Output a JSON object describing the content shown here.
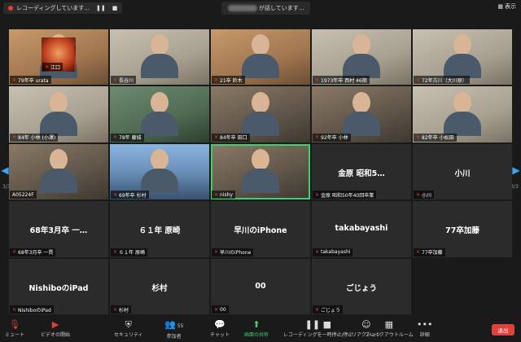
{
  "topbar": {
    "recording_text": "レコーディングしています...",
    "speaking_text": "が話しています...",
    "view_label": "表示"
  },
  "pager": {
    "left_page": "3/3",
    "right_page": "3/3"
  },
  "tiles": [
    {
      "name": "79年卒 urata",
      "center": "",
      "style": "video warm",
      "mic_off": true
    },
    {
      "name": "長谷川",
      "center": "",
      "style": "video light",
      "mic_off": true
    },
    {
      "name": "21卒 鈴木",
      "center": "",
      "style": "video warm",
      "mic_off": true
    },
    {
      "name": "1973年卒 西村 46期",
      "center": "",
      "style": "video light",
      "mic_off": true
    },
    {
      "name": "72年古川（大川原）",
      "center": "",
      "style": "video light",
      "mic_off": true
    },
    {
      "name": "84年 小林 (小澤)",
      "center": "",
      "style": "video light",
      "mic_off": true
    },
    {
      "name": "78年 藤城",
      "center": "",
      "style": "video green",
      "mic_off": true
    },
    {
      "name": "84年卒 田口",
      "center": "",
      "style": "video",
      "mic_off": true
    },
    {
      "name": "92年卒 小林",
      "center": "",
      "style": "video",
      "mic_off": true
    },
    {
      "name": "82年卒 小松田",
      "center": "",
      "style": "video light",
      "mic_off": true
    },
    {
      "name": "A05224F",
      "center": "",
      "style": "video",
      "mic_off": false
    },
    {
      "name": "69年卒 杉村",
      "center": "",
      "style": "video blue",
      "mic_off": true
    },
    {
      "name": "nishy",
      "center": "",
      "style": "video active",
      "mic_off": true
    },
    {
      "name": "金原 昭和50年40回卒業",
      "center": "金原 昭和5…",
      "style": "",
      "mic_off": true
    },
    {
      "name": "小川",
      "center": "小川",
      "style": "",
      "mic_off": true
    },
    {
      "name": "68年3月卒 一貫",
      "center": "68年3月卒 一…",
      "style": "",
      "mic_off": true
    },
    {
      "name": "６１年 原崎",
      "center": "６１年 原崎",
      "style": "",
      "mic_off": true
    },
    {
      "name": "早川のiPhone",
      "center": "早川のiPhone",
      "style": "",
      "mic_off": true
    },
    {
      "name": "takabayashi",
      "center": "takabayashi",
      "style": "",
      "mic_off": true
    },
    {
      "name": "77卒加藤",
      "center": "77卒加藤",
      "style": "",
      "mic_off": true
    },
    {
      "name": "NishiboのiPad",
      "center": "NishiboのiPad",
      "style": "",
      "mic_off": true
    },
    {
      "name": "杉村",
      "center": "杉村",
      "style": "",
      "mic_off": true
    },
    {
      "name": "江口",
      "center": "",
      "style": "moon",
      "mic_off": true
    },
    {
      "name": "00",
      "center": "00",
      "style": "",
      "mic_off": true
    },
    {
      "name": "ごじょう",
      "center": "ごじょう",
      "style": "",
      "mic_off": true
    }
  ],
  "toolbar": {
    "mute": "ミュート",
    "video": "ビデオの開始",
    "security": "セキュリティ",
    "participants": "参加者",
    "participants_count": "55",
    "chat": "チャット",
    "share": "画面の共有",
    "record": "レコーディングを一時停止/停止",
    "reactions": "リアクション",
    "breakout": "ブレイクアウトルーム",
    "more": "詳細",
    "end": "退出"
  }
}
